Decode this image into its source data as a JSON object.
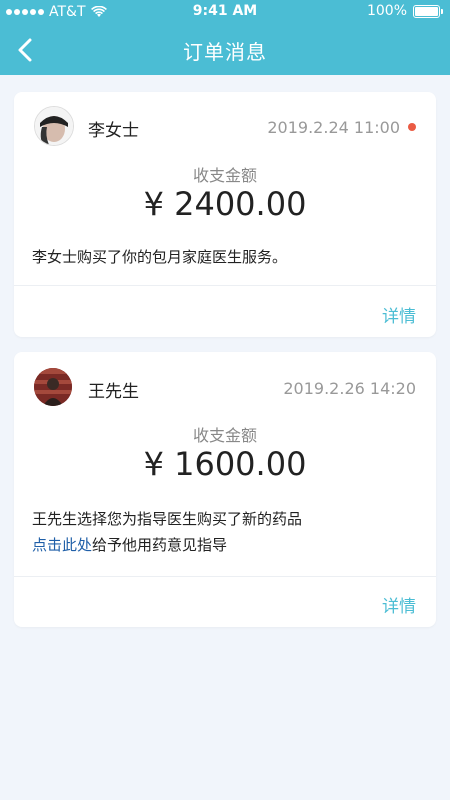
{
  "status_bar": {
    "carrier": "AT&T",
    "time": "9:41 AM",
    "battery": "100%"
  },
  "nav": {
    "title": "订单消息"
  },
  "orders": [
    {
      "name": "李女士",
      "time": "2019.2.24 11:00",
      "unread": true,
      "amount_label": "收支金额",
      "amount": "¥ 2400.00",
      "description": "李女士购买了你的包月家庭医生服务。",
      "detail_label": "详情"
    },
    {
      "name": "王先生",
      "time": "2019.2.26 14:20",
      "unread": false,
      "amount_label": "收支金额",
      "amount": "¥ 1600.00",
      "description_line1": "王先生选择您为指导医生购买了新的药品",
      "link_text": "点击此处",
      "description_line2_rest": "给予他用药意见指导",
      "detail_label": "详情"
    }
  ],
  "colors": {
    "header": "#4bbdd4",
    "accent": "#4bbdd4",
    "unread_dot": "#ea5b44",
    "link": "#1f5fa8",
    "background": "#f1f5fb"
  },
  "icons": {
    "back": "chevron-left-icon",
    "wifi": "wifi-icon",
    "battery": "battery-icon",
    "signal": "signal-dots-icon"
  }
}
